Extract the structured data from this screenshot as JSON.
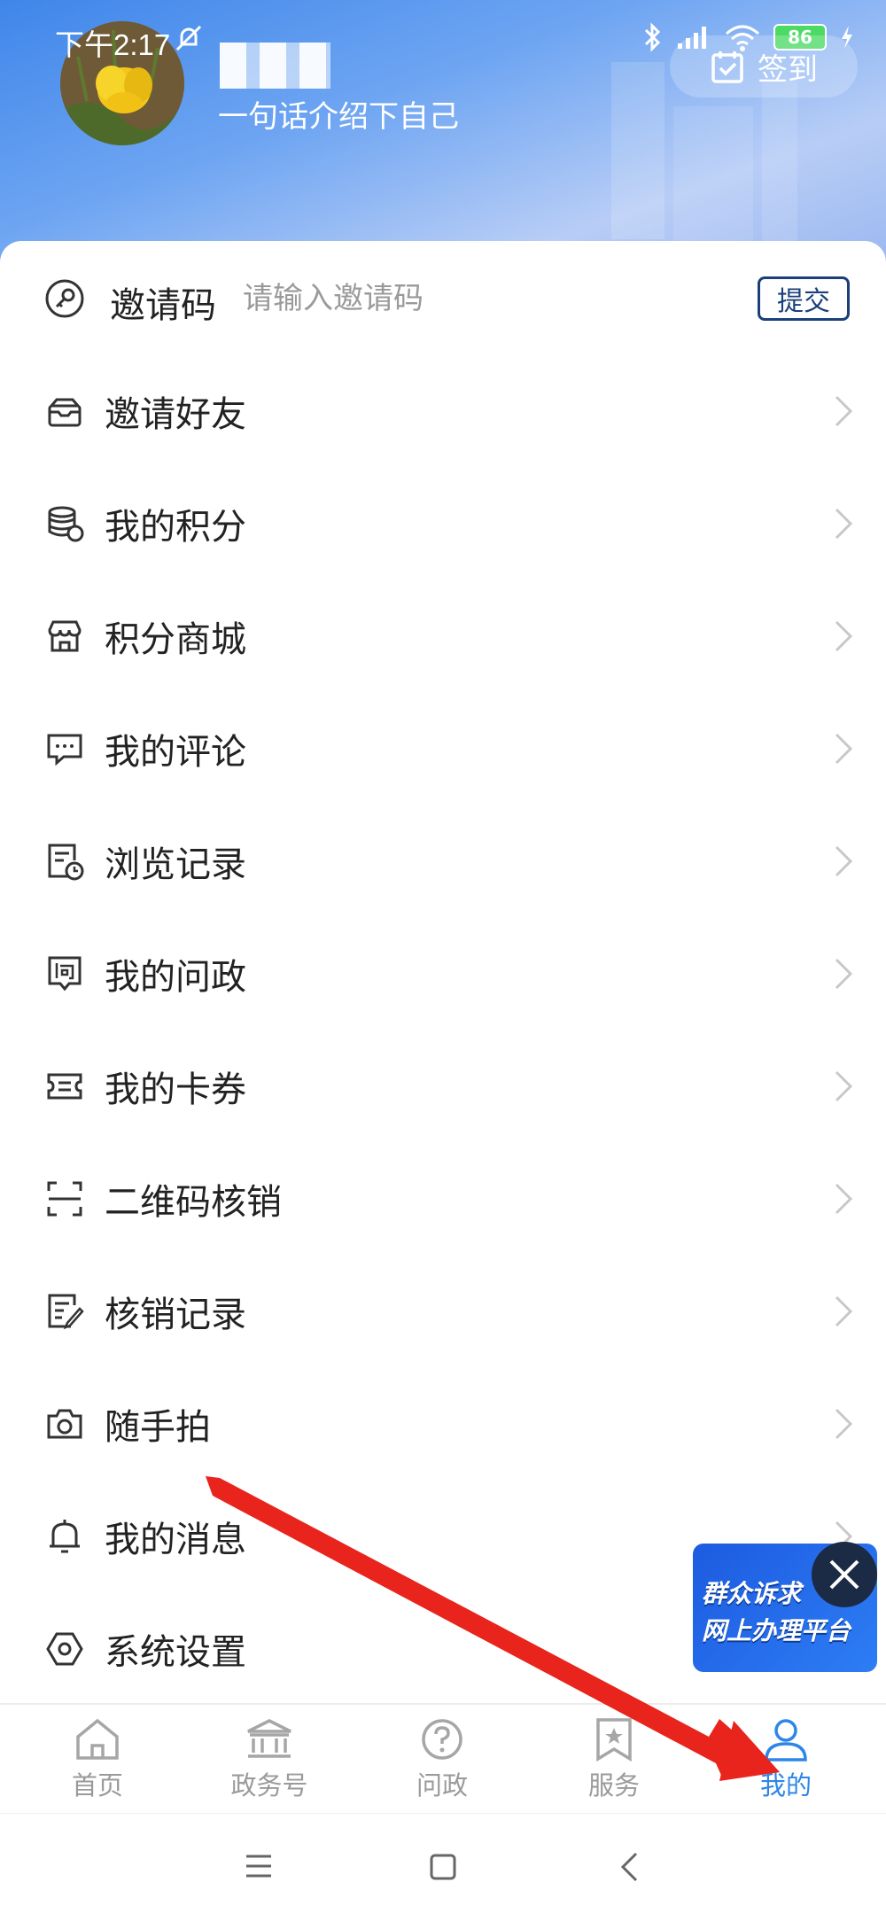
{
  "status_bar": {
    "time": "下午2:17",
    "battery": "86"
  },
  "profile": {
    "signature": "一句话介绍下自己",
    "signin_label": "签到"
  },
  "invite": {
    "label": "邀请码",
    "placeholder": "请输入邀请码",
    "submit_label": "提交"
  },
  "menu": [
    {
      "label": "邀请好友",
      "icon": "envelope-icon"
    },
    {
      "label": "我的积分",
      "icon": "coins-icon"
    },
    {
      "label": "积分商城",
      "icon": "store-icon"
    },
    {
      "label": "我的评论",
      "icon": "comment-icon"
    },
    {
      "label": "浏览记录",
      "icon": "history-icon"
    },
    {
      "label": "我的问政",
      "icon": "question-chat-icon"
    },
    {
      "label": "我的卡券",
      "icon": "ticket-icon"
    },
    {
      "label": "二维码核销",
      "icon": "scan-icon"
    },
    {
      "label": "核销记录",
      "icon": "edit-record-icon"
    },
    {
      "label": "随手拍",
      "icon": "camera-icon"
    },
    {
      "label": "我的消息",
      "icon": "bell-icon"
    },
    {
      "label": "系统设置",
      "icon": "settings-icon"
    }
  ],
  "float_banner": {
    "line1": "群众诉求",
    "line2": "网上办理平台"
  },
  "tabbar": {
    "tabs": [
      {
        "label": "首页",
        "icon": "home-icon"
      },
      {
        "label": "政务号",
        "icon": "government-icon"
      },
      {
        "label": "问政",
        "icon": "question-icon"
      },
      {
        "label": "服务",
        "icon": "star-bookmark-icon"
      },
      {
        "label": "我的",
        "icon": "user-icon"
      }
    ],
    "active_index": 4
  },
  "colors": {
    "accent": "#2d86e8",
    "submit_border": "#1a3f7a",
    "annotation_arrow": "#e8241c"
  }
}
